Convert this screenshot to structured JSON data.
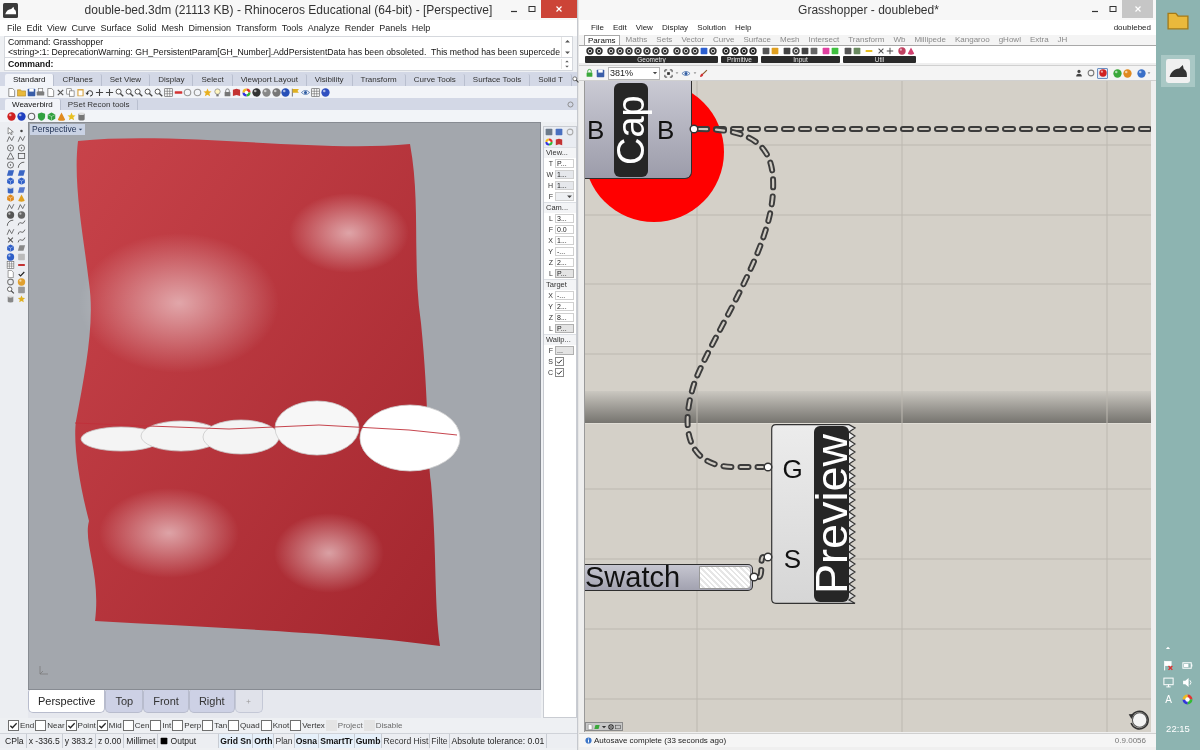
{
  "rhino": {
    "title": "double-bed.3dm (21113 KB) - Rhinoceros Educational (64-bit) - [Perspective]",
    "menu": [
      "File",
      "Edit",
      "View",
      "Curve",
      "Surface",
      "Solid",
      "Mesh",
      "Dimension",
      "Transform",
      "Tools",
      "Analyze",
      "Render",
      "Panels",
      "Help"
    ],
    "command_history": [
      "Command: Grasshopper",
      "<string>:1: DeprecationWarning: GH_PersistentParam[GH_Number].AddPersistentData has been obsoleted.  This method has been supercede"
    ],
    "command_prompt": "Command:",
    "toolbar_tabs": [
      {
        "label": "Standard",
        "selected": true
      },
      {
        "label": "CPlanes",
        "selected": false
      },
      {
        "label": "Set View",
        "selected": false
      },
      {
        "label": "Display",
        "selected": false
      },
      {
        "label": "Select",
        "selected": false
      },
      {
        "label": "Viewport Layout",
        "selected": false
      },
      {
        "label": "Visibility",
        "selected": false
      },
      {
        "label": "Transform",
        "selected": false
      },
      {
        "label": "Curve Tools",
        "selected": false
      },
      {
        "label": "Surface Tools",
        "selected": false
      },
      {
        "label": "Solid T",
        "selected": false
      }
    ],
    "plugin_tabs": [
      {
        "label": "Weaverbird",
        "selected": true
      },
      {
        "label": "PSet Recon tools",
        "selected": false
      }
    ],
    "viewport": {
      "label": "Perspective"
    },
    "properties": [
      {
        "title": "View...",
        "rows": [
          {
            "kind": "text",
            "label": "T",
            "value": "P..."
          },
          {
            "kind": "readonly",
            "label": "W",
            "value": "1..."
          },
          {
            "kind": "readonly",
            "label": "H",
            "value": "1..."
          },
          {
            "kind": "dropdown",
            "label": "F"
          }
        ]
      },
      {
        "title": "Cam...",
        "rows": [
          {
            "kind": "text",
            "label": "L",
            "value": "3..."
          },
          {
            "kind": "text",
            "label": "F",
            "value": "0.0"
          },
          {
            "kind": "text",
            "label": "X",
            "value": "1..."
          },
          {
            "kind": "text",
            "label": "Y",
            "value": "-..."
          },
          {
            "kind": "text",
            "label": "Z",
            "value": "2..."
          },
          {
            "kind": "button",
            "label": "L",
            "value": "P..."
          }
        ]
      },
      {
        "title": "Target",
        "rows": [
          {
            "kind": "text",
            "label": "X",
            "value": "-..."
          },
          {
            "kind": "text",
            "label": "Y",
            "value": "2..."
          },
          {
            "kind": "text",
            "label": "Z",
            "value": "8..."
          },
          {
            "kind": "button",
            "label": "L",
            "value": "P..."
          }
        ]
      },
      {
        "title": "Wallp...",
        "rows": [
          {
            "kind": "button",
            "label": "F",
            "value": "..."
          },
          {
            "kind": "checkbox",
            "label": "S",
            "checked": true
          },
          {
            "kind": "checkbox",
            "label": "C",
            "checked": true
          }
        ]
      }
    ],
    "viewport_tabs": [
      {
        "label": "Perspective",
        "selected": true
      },
      {
        "label": "Top",
        "selected": false
      },
      {
        "label": "Front",
        "selected": false
      },
      {
        "label": "Right",
        "selected": false
      }
    ],
    "osnaps": [
      {
        "label": "End",
        "checked": true,
        "disabled": false
      },
      {
        "label": "Near",
        "checked": false,
        "disabled": false
      },
      {
        "label": "Point",
        "checked": true,
        "disabled": false
      },
      {
        "label": "Mid",
        "checked": true,
        "disabled": false
      },
      {
        "label": "Cen",
        "checked": false,
        "disabled": false
      },
      {
        "label": "Int",
        "checked": false,
        "disabled": false
      },
      {
        "label": "Perp",
        "checked": false,
        "disabled": false
      },
      {
        "label": "Tan",
        "checked": false,
        "disabled": false
      },
      {
        "label": "Quad",
        "checked": false,
        "disabled": false
      },
      {
        "label": "Knot",
        "checked": false,
        "disabled": false
      },
      {
        "label": "Vertex",
        "checked": false,
        "disabled": false
      },
      {
        "label": "Project",
        "checked": false,
        "disabled": true
      },
      {
        "label": "Disable",
        "checked": false,
        "disabled": true
      }
    ],
    "status": {
      "cplane": "CPla",
      "x": "x -336.5",
      "y": "y 383.2",
      "z": "z 0.00",
      "units": "Millimet",
      "layer": "Output",
      "toggles": [
        {
          "label": "Grid Sn",
          "on": true
        },
        {
          "label": "Orth",
          "on": true
        },
        {
          "label": "Plan",
          "on": false
        },
        {
          "label": "Osna",
          "on": true
        },
        {
          "label": "SmartTr",
          "on": true
        },
        {
          "label": "Gumb",
          "on": true
        },
        {
          "label": "Record Hist",
          "on": false
        },
        {
          "label": "Filte",
          "on": false
        }
      ],
      "tolerance": "Absolute tolerance: 0.01"
    }
  },
  "grasshopper": {
    "title": "Grasshopper - doublebed*",
    "menu": [
      "File",
      "Edit",
      "View",
      "Display",
      "Solution",
      "Help"
    ],
    "document": "doublebed",
    "tabs": [
      {
        "label": "Params",
        "selected": true
      },
      {
        "label": "Maths",
        "selected": false
      },
      {
        "label": "Sets",
        "selected": false
      },
      {
        "label": "Vector",
        "selected": false
      },
      {
        "label": "Curve",
        "selected": false
      },
      {
        "label": "Surface",
        "selected": false
      },
      {
        "label": "Mesh",
        "selected": false
      },
      {
        "label": "Intersect",
        "selected": false
      },
      {
        "label": "Transform",
        "selected": false
      },
      {
        "label": "Wb",
        "selected": false
      },
      {
        "label": "Millipede",
        "selected": false
      },
      {
        "label": "Kangaroo",
        "selected": false
      },
      {
        "label": "gHowl",
        "selected": false
      },
      {
        "label": "Extra",
        "selected": false
      },
      {
        "label": "JH",
        "selected": false
      }
    ],
    "panel_groups": [
      "Geometry",
      "Primitive",
      "Input",
      "Util"
    ],
    "zoom": "381%",
    "preview_modes": [
      {
        "selected": false
      },
      {
        "selected": false
      },
      {
        "selected": true
      }
    ],
    "components": [
      {
        "kind": "param",
        "name": "Cap",
        "inputs": [
          "B"
        ],
        "outputs": [
          "B"
        ]
      },
      {
        "kind": "preview",
        "name": "Preview",
        "inputs": [
          "G",
          "S"
        ]
      },
      {
        "kind": "swatch",
        "name": "Swatch"
      }
    ],
    "status": "Autosave complete (33 seconds ago)",
    "version": "0.9.0056"
  },
  "taskbar": {
    "input_indicator": "A",
    "clock": "22:15"
  }
}
